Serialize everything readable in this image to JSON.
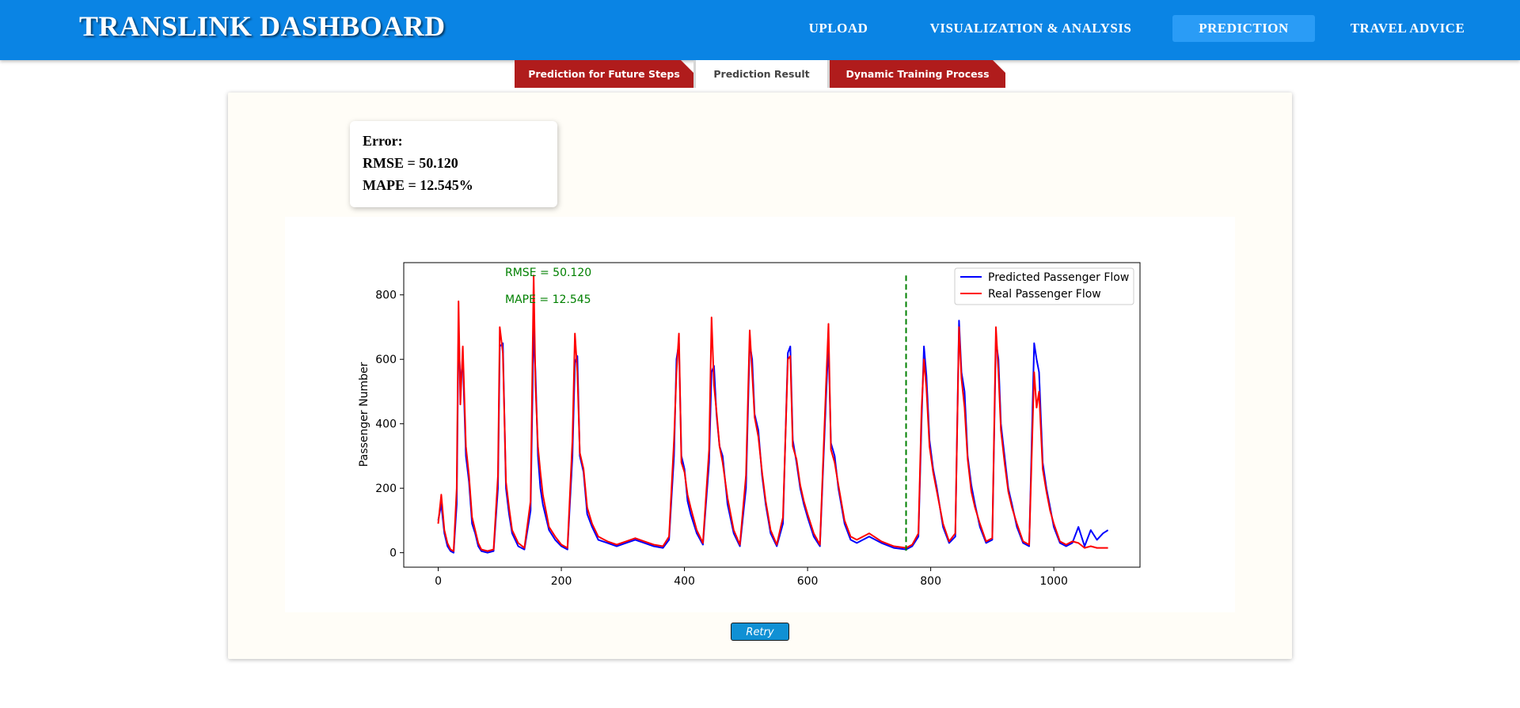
{
  "header": {
    "brand": "TRANSLINK DASHBOARD",
    "nav": [
      {
        "label": "UPLOAD"
      },
      {
        "label": "VISUALIZATION & ANALYSIS"
      },
      {
        "label": "PREDICTION"
      },
      {
        "label": "TRAVEL ADVICE"
      }
    ],
    "active_nav": "PREDICTION"
  },
  "tabs": [
    {
      "label": "Prediction for Future Steps"
    },
    {
      "label": "Prediction Result"
    },
    {
      "label": "Dynamic Training Process"
    }
  ],
  "active_tab": "Prediction Result",
  "error_card": {
    "title": "Error:",
    "rmse": "RMSE = 50.120",
    "mape": "MAPE = 12.545%"
  },
  "retry_label": "Retry",
  "colors": {
    "header_bg": "#0a84e4",
    "active_nav_bg": "#2a9cf6",
    "tab_red": "#b01c1c",
    "predicted": "#0000ff",
    "real": "#ff0000",
    "annotation": "#008000",
    "retry_bg": "#1090d4"
  },
  "chart_data": {
    "type": "line",
    "title": "",
    "xlabel": "",
    "ylabel": "Passenger Number",
    "xlim": [
      -56,
      1140
    ],
    "ylim": [
      -45,
      900
    ],
    "xticks": [
      0,
      200,
      400,
      600,
      800,
      1000
    ],
    "yticks": [
      0,
      200,
      400,
      600,
      800
    ],
    "legend_position": "top-right",
    "grid": false,
    "annotations": [
      "RMSE = 50.120",
      "MAPE = 12.545"
    ],
    "vline_x": 760,
    "series": [
      {
        "name": "Predicted Passenger Flow",
        "color": "#0000ff",
        "x": [
          0,
          5,
          10,
          15,
          20,
          25,
          30,
          33,
          36,
          40,
          45,
          50,
          55,
          60,
          65,
          70,
          80,
          90,
          97,
          100,
          105,
          110,
          115,
          120,
          130,
          140,
          150,
          155,
          158,
          162,
          166,
          170,
          175,
          180,
          190,
          200,
          210,
          218,
          222,
          226,
          230,
          236,
          242,
          250,
          260,
          275,
          290,
          305,
          320,
          335,
          350,
          365,
          375,
          383,
          387,
          391,
          395,
          400,
          405,
          410,
          420,
          430,
          440,
          444,
          448,
          452,
          457,
          462,
          470,
          480,
          490,
          500,
          506,
          510,
          514,
          520,
          526,
          532,
          540,
          550,
          560,
          568,
          572,
          576,
          582,
          588,
          594,
          600,
          610,
          620,
          630,
          634,
          638,
          644,
          650,
          660,
          670,
          680,
          700,
          720,
          740,
          760,
          770,
          780,
          785,
          789,
          793,
          798,
          804,
          810,
          820,
          830,
          840,
          846,
          850,
          855,
          860,
          866,
          872,
          880,
          890,
          900,
          906,
          910,
          914,
          920,
          926,
          932,
          940,
          950,
          960,
          968,
          972,
          976,
          982,
          988,
          994,
          1000,
          1010,
          1020,
          1030,
          1040,
          1050,
          1060,
          1070,
          1080,
          1088
        ],
        "y": [
          100,
          150,
          60,
          20,
          5,
          0,
          150,
          700,
          520,
          600,
          300,
          220,
          90,
          60,
          20,
          5,
          0,
          5,
          200,
          640,
          650,
          200,
          120,
          60,
          20,
          10,
          130,
          700,
          560,
          300,
          200,
          150,
          110,
          70,
          40,
          20,
          10,
          300,
          590,
          610,
          300,
          250,
          120,
          80,
          40,
          30,
          20,
          30,
          40,
          30,
          20,
          15,
          40,
          300,
          600,
          650,
          300,
          260,
          160,
          120,
          60,
          25,
          280,
          560,
          580,
          430,
          330,
          300,
          150,
          60,
          20,
          200,
          650,
          600,
          430,
          380,
          240,
          150,
          60,
          20,
          90,
          620,
          640,
          350,
          280,
          200,
          150,
          110,
          50,
          20,
          480,
          650,
          340,
          300,
          200,
          90,
          40,
          30,
          50,
          30,
          15,
          10,
          20,
          50,
          400,
          640,
          550,
          350,
          260,
          200,
          80,
          30,
          50,
          720,
          560,
          500,
          300,
          210,
          150,
          80,
          30,
          40,
          660,
          600,
          400,
          300,
          200,
          150,
          80,
          30,
          20,
          650,
          600,
          560,
          280,
          200,
          140,
          80,
          30,
          20,
          30,
          80,
          20,
          70,
          40,
          60,
          70
        ]
      },
      {
        "name": "Real Passenger Flow",
        "color": "#ff0000",
        "x": [
          0,
          5,
          10,
          15,
          20,
          25,
          30,
          33,
          36,
          40,
          45,
          50,
          55,
          60,
          65,
          70,
          80,
          90,
          97,
          100,
          105,
          110,
          115,
          120,
          130,
          140,
          150,
          155,
          158,
          162,
          166,
          170,
          175,
          180,
          190,
          200,
          210,
          218,
          222,
          226,
          230,
          236,
          242,
          250,
          260,
          275,
          290,
          305,
          320,
          335,
          350,
          365,
          375,
          383,
          387,
          391,
          395,
          400,
          405,
          410,
          420,
          430,
          440,
          444,
          448,
          452,
          457,
          462,
          470,
          480,
          490,
          500,
          506,
          510,
          514,
          520,
          526,
          532,
          540,
          550,
          560,
          568,
          572,
          576,
          582,
          588,
          594,
          600,
          610,
          620,
          630,
          634,
          638,
          644,
          650,
          660,
          670,
          680,
          700,
          720,
          740,
          760,
          770,
          780,
          785,
          789,
          793,
          798,
          804,
          810,
          820,
          830,
          840,
          846,
          850,
          855,
          860,
          866,
          872,
          880,
          890,
          900,
          906,
          910,
          914,
          920,
          926,
          932,
          940,
          950,
          960,
          968,
          972,
          976,
          982,
          988,
          994,
          1000,
          1010,
          1020,
          1030,
          1040,
          1050,
          1060,
          1070,
          1080,
          1088
        ],
        "y": [
          90,
          180,
          70,
          30,
          10,
          5,
          200,
          780,
          460,
          640,
          330,
          240,
          110,
          70,
          30,
          10,
          5,
          10,
          240,
          700,
          620,
          220,
          140,
          70,
          30,
          15,
          160,
          860,
          520,
          330,
          250,
          180,
          130,
          80,
          50,
          25,
          15,
          350,
          680,
          560,
          310,
          260,
          140,
          90,
          50,
          35,
          25,
          35,
          45,
          35,
          25,
          20,
          50,
          350,
          560,
          680,
          280,
          250,
          180,
          140,
          70,
          30,
          320,
          730,
          520,
          440,
          330,
          280,
          170,
          70,
          25,
          240,
          690,
          560,
          420,
          360,
          250,
          160,
          70,
          25,
          110,
          600,
          610,
          330,
          290,
          210,
          160,
          120,
          60,
          25,
          520,
          710,
          320,
          280,
          210,
          100,
          50,
          40,
          60,
          35,
          20,
          15,
          25,
          60,
          440,
          600,
          510,
          330,
          250,
          190,
          90,
          35,
          60,
          700,
          540,
          450,
          290,
          190,
          140,
          90,
          35,
          45,
          700,
          560,
          380,
          280,
          190,
          140,
          90,
          35,
          25,
          560,
          450,
          500,
          260,
          190,
          130,
          90,
          35,
          25,
          35,
          30,
          15,
          20,
          15,
          15,
          15
        ]
      }
    ]
  }
}
